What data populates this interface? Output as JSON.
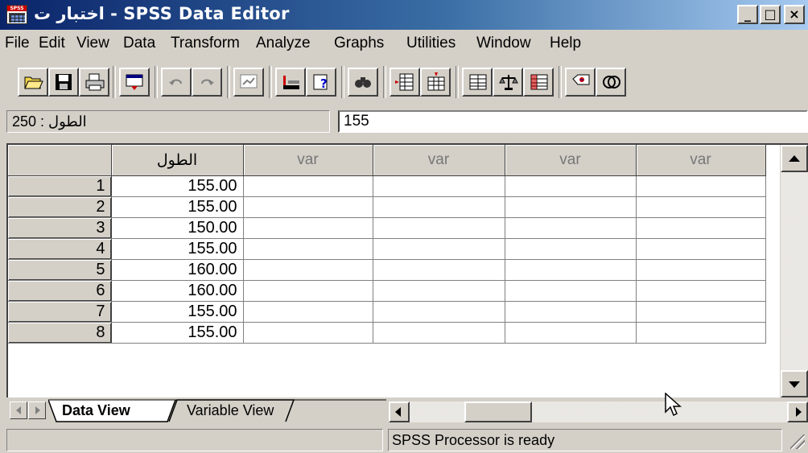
{
  "window": {
    "title": "اختبار ت - SPSS Data Editor",
    "icon_caption": "SPSS",
    "controls": {
      "minimize": "_",
      "maximize": "□",
      "close": "×"
    }
  },
  "menu": [
    {
      "label": "File"
    },
    {
      "label": "Edit"
    },
    {
      "label": "View"
    },
    {
      "label": "Data"
    },
    {
      "label": "Transform"
    },
    {
      "label": "Analyze"
    },
    {
      "label": "Graphs"
    },
    {
      "label": "Utilities"
    },
    {
      "label": "Window"
    },
    {
      "label": "Help"
    }
  ],
  "toolbar": {
    "buttons": [
      {
        "name": "open-icon"
      },
      {
        "name": "save-icon"
      },
      {
        "name": "print-icon"
      },
      {
        "name": "dialog-recall-icon"
      },
      {
        "name": "undo-icon"
      },
      {
        "name": "redo-icon"
      },
      {
        "name": "goto-chart-icon"
      },
      {
        "name": "goto-case-icon"
      },
      {
        "name": "variables-icon"
      },
      {
        "name": "find-icon"
      },
      {
        "name": "insert-cases-icon"
      },
      {
        "name": "insert-variable-icon"
      },
      {
        "name": "split-file-icon"
      },
      {
        "name": "weight-cases-icon"
      },
      {
        "name": "select-cases-icon"
      },
      {
        "name": "value-labels-icon"
      },
      {
        "name": "use-sets-icon"
      }
    ]
  },
  "cell_editor": {
    "cell_reference": "الطول : 250",
    "value": "155"
  },
  "grid": {
    "columns": [
      "الطول",
      "var",
      "var",
      "var",
      "var"
    ],
    "rows": [
      {
        "row": "1",
        "value": "155.00"
      },
      {
        "row": "2",
        "value": "155.00"
      },
      {
        "row": "3",
        "value": "150.00"
      },
      {
        "row": "4",
        "value": "155.00"
      },
      {
        "row": "5",
        "value": "160.00"
      },
      {
        "row": "6",
        "value": "160.00"
      },
      {
        "row": "7",
        "value": "155.00"
      },
      {
        "row": "8",
        "value": "155.00"
      }
    ]
  },
  "tabs": {
    "data_view": "Data View",
    "variable_view": "Variable View",
    "active": "Data View"
  },
  "status": {
    "text": "SPSS Processor  is ready"
  }
}
